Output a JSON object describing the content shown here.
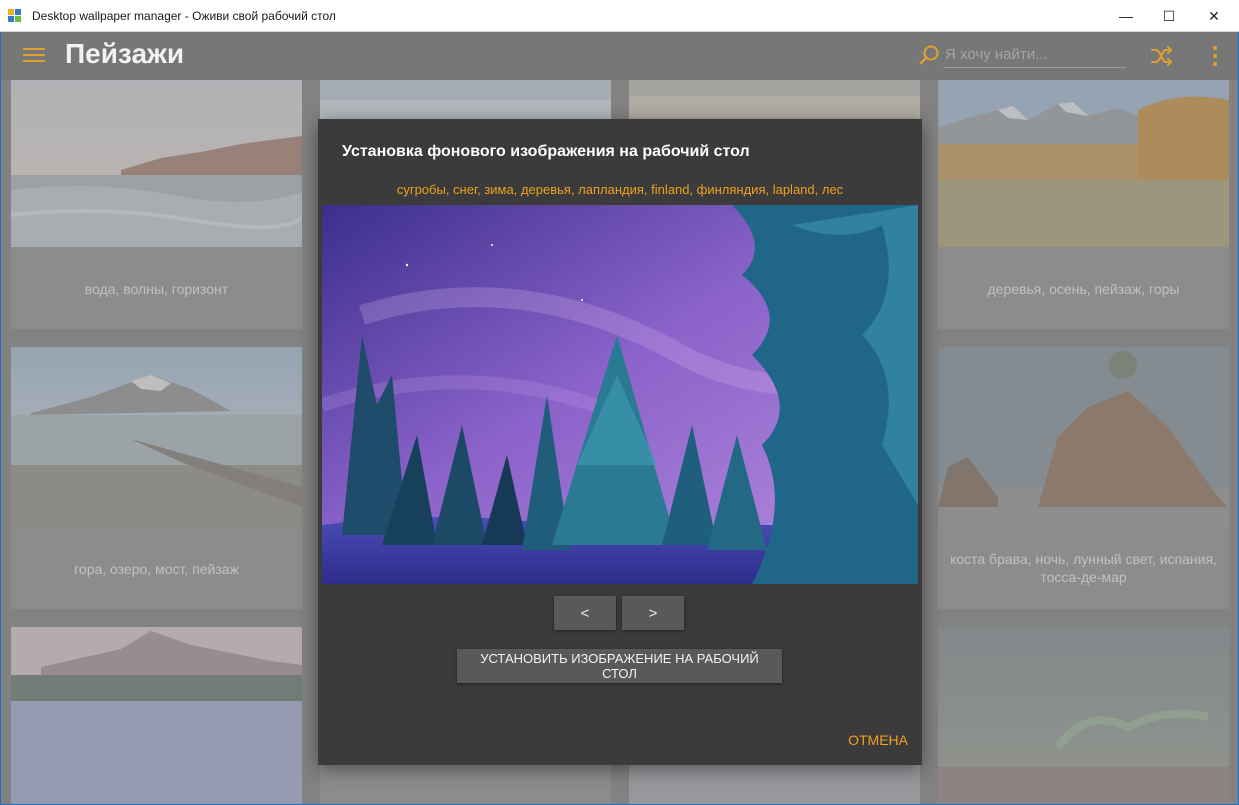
{
  "window": {
    "title": "Desktop wallpaper manager - Оживи свой рабочий стол",
    "minimize": "—",
    "maximize": "☐",
    "close": "✕"
  },
  "appbar": {
    "page_title": "Пейзажи",
    "search_placeholder": "Я хочу найти...",
    "accent": "#e0a030"
  },
  "grid": {
    "cards": [
      {
        "caption": "вода, волны, горизонт"
      },
      {
        "caption": "деревья, осень, пейзаж, горы"
      },
      {
        "caption": "гора, озеро, мост, пейзаж"
      },
      {
        "caption": "коста брава, ночь, лунный свет, испания, тосса-де-мар"
      }
    ]
  },
  "dialog": {
    "title": "Установка фонового изображения на рабочий стол",
    "tags": "сугробы, снег, зима, деревья, лапландия, finland, финляндия, lapland, лес",
    "prev_label": "<",
    "next_label": ">",
    "set_label": "УСТАНОВИТЬ ИЗОБРАЖЕНИЕ НА РАБОЧИЙ СТОЛ",
    "cancel_label": "ОТМЕНА",
    "accent": "#f0a020"
  }
}
